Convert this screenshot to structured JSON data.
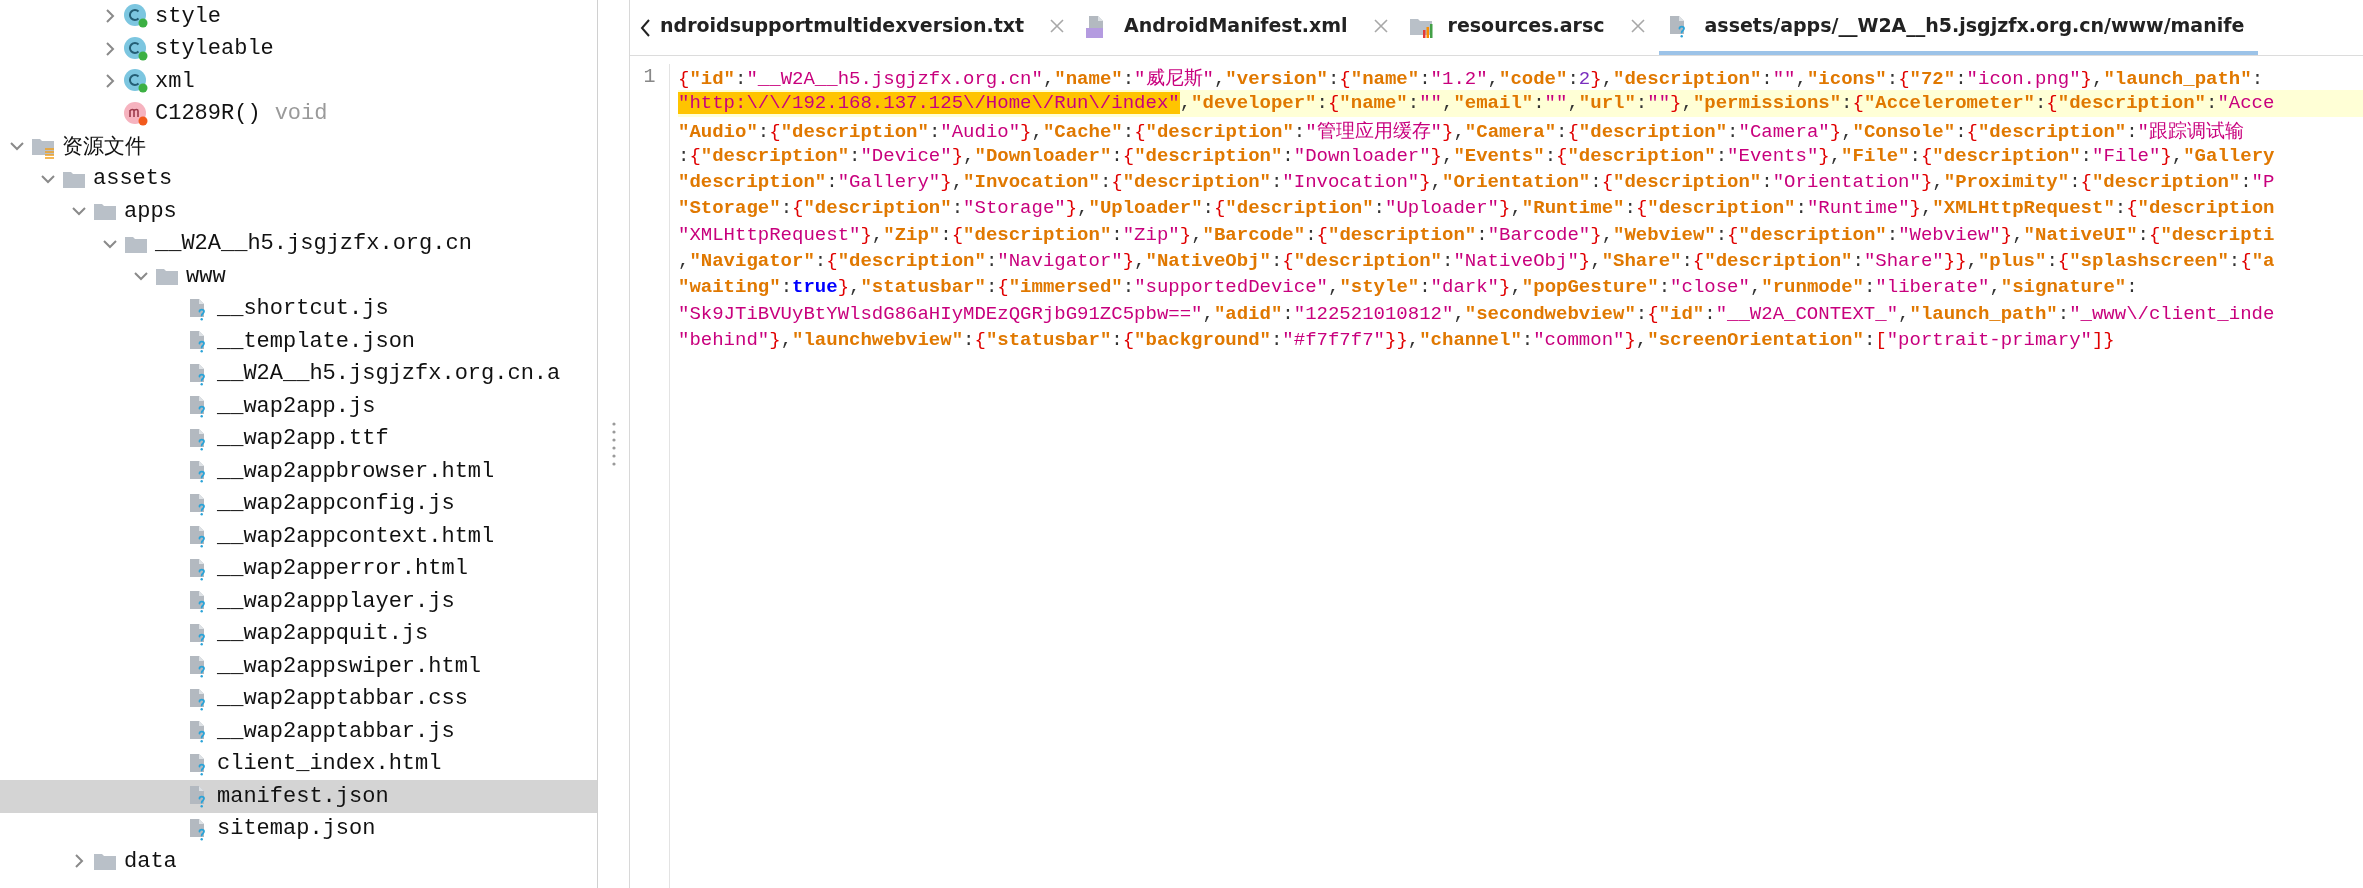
{
  "tree": {
    "partial_items": [
      {
        "label": "style",
        "kind": "class",
        "expanded": false,
        "selected": false
      },
      {
        "label": "styleable",
        "kind": "class",
        "expanded": false,
        "selected": false
      },
      {
        "label": "xml",
        "kind": "class",
        "expanded": false,
        "selected": false
      },
      {
        "label": "C1289R()",
        "suffix": "void",
        "kind": "method",
        "selected": false
      }
    ],
    "items": [
      {
        "label": "资源文件",
        "kind": "resources",
        "expanded": true,
        "selected": false,
        "children": [
          {
            "label": "assets",
            "kind": "folder",
            "expanded": true,
            "selected": false,
            "children": [
              {
                "label": "apps",
                "kind": "folder",
                "expanded": true,
                "selected": false,
                "children": [
                  {
                    "label": "__W2A__h5.jsgjzfx.org.cn",
                    "kind": "folder",
                    "expanded": true,
                    "selected": false,
                    "children": [
                      {
                        "label": "www",
                        "kind": "folder",
                        "expanded": true,
                        "selected": false,
                        "children": [
                          {
                            "label": "__shortcut.js",
                            "kind": "file",
                            "selected": false
                          },
                          {
                            "label": "__template.json",
                            "kind": "file",
                            "selected": false
                          },
                          {
                            "label": "__W2A__h5.jsgjzfx.org.cn.a",
                            "kind": "file",
                            "selected": false
                          },
                          {
                            "label": "__wap2app.js",
                            "kind": "file",
                            "selected": false
                          },
                          {
                            "label": "__wap2app.ttf",
                            "kind": "file",
                            "selected": false
                          },
                          {
                            "label": "__wap2appbrowser.html",
                            "kind": "file",
                            "selected": false
                          },
                          {
                            "label": "__wap2appconfig.js",
                            "kind": "file",
                            "selected": false
                          },
                          {
                            "label": "__wap2appcontext.html",
                            "kind": "file",
                            "selected": false
                          },
                          {
                            "label": "__wap2apperror.html",
                            "kind": "file",
                            "selected": false
                          },
                          {
                            "label": "__wap2appplayer.js",
                            "kind": "file",
                            "selected": false
                          },
                          {
                            "label": "__wap2appquit.js",
                            "kind": "file",
                            "selected": false
                          },
                          {
                            "label": "__wap2appswiper.html",
                            "kind": "file",
                            "selected": false
                          },
                          {
                            "label": "__wap2apptabbar.css",
                            "kind": "file",
                            "selected": false
                          },
                          {
                            "label": "__wap2apptabbar.js",
                            "kind": "file",
                            "selected": false
                          },
                          {
                            "label": "client_index.html",
                            "kind": "file",
                            "selected": false
                          },
                          {
                            "label": "manifest.json",
                            "kind": "file",
                            "selected": true
                          },
                          {
                            "label": "sitemap.json",
                            "kind": "file",
                            "selected": false
                          }
                        ]
                      }
                    ]
                  }
                ]
              },
              {
                "label": "data",
                "kind": "folder",
                "expanded": false,
                "selected": false
              }
            ]
          }
        ]
      }
    ]
  },
  "tabs": [
    {
      "label": "ndroidsupportmultidexversion.txt",
      "kind": "none",
      "selected": false
    },
    {
      "label": "AndroidManifest.xml",
      "kind": "manifest",
      "selected": false
    },
    {
      "label": "resources.arsc",
      "kind": "resources-table",
      "selected": false
    },
    {
      "label": "assets/apps/__W2A__h5.jsgjzfx.org.cn/www/manife",
      "kind": "file",
      "selected": true
    }
  ],
  "editor": {
    "line_number": "1",
    "rows": [
      {
        "current": false,
        "segments": [
          {
            "text": "{\"id\":\"__W2A__h5.jsgjzfx.org.cn\",\"name\":\"威尼斯\",\"version\":{\"name\":\"1.2\",\"code\":2},\"description\":\"\",\"icons\":{\"72\":\"icon.png\"},\"launch_path\":",
            "selected": false
          }
        ]
      },
      {
        "current": true,
        "segments": [
          {
            "text": "\"http:\\/\\/192.168.137.125\\/Home\\/Run\\/index\"",
            "selected": true
          },
          {
            "text": ",\"developer\":{\"name\":\"\",\"email\":\"\",\"url\":\"\"},\"permissions\":{\"Accelerometer\":{\"description\":\"Acce",
            "selected": false
          }
        ]
      },
      {
        "current": false,
        "segments": [
          {
            "text": "\"Audio\":{\"description\":\"Audio\"},\"Cache\":{\"description\":\"管理应用缓存\"},\"Camera\":{\"description\":\"Camera\"},\"Console\":{\"description\":\"跟踪调试输",
            "selected": false
          }
        ]
      },
      {
        "current": false,
        "segments": [
          {
            "text": ":{\"description\":\"Device\"},\"Downloader\":{\"description\":\"Downloader\"},\"Events\":{\"description\":\"Events\"},\"File\":{\"description\":\"File\"},\"Gallery",
            "selected": false
          }
        ]
      },
      {
        "current": false,
        "segments": [
          {
            "text": "\"description\":\"Gallery\"},\"Invocation\":{\"description\":\"Invocation\"},\"Orientation\":{\"description\":\"Orientation\"},\"Proximity\":{\"description\":\"P",
            "selected": false
          }
        ]
      },
      {
        "current": false,
        "segments": [
          {
            "text": "\"Storage\":{\"description\":\"Storage\"},\"Uploader\":{\"description\":\"Uploader\"},\"Runtime\":{\"description\":\"Runtime\"},\"XMLHttpRequest\":{\"description",
            "selected": false
          }
        ]
      },
      {
        "current": false,
        "segments": [
          {
            "text": "\"XMLHttpRequest\"},\"Zip\":{\"description\":\"Zip\"},\"Barcode\":{\"description\":\"Barcode\"},\"Webview\":{\"description\":\"Webview\"},\"NativeUI\":{\"descripti",
            "selected": false
          }
        ]
      },
      {
        "current": false,
        "segments": [
          {
            "text": ",\"Navigator\":{\"description\":\"Navigator\"},\"NativeObj\":{\"description\":\"NativeObj\"},\"Share\":{\"description\":\"Share\"}},\"plus\":{\"splashscreen\":{\"a",
            "selected": false
          }
        ]
      },
      {
        "current": false,
        "segments": [
          {
            "text": "\"waiting\":true},\"statusbar\":{\"immersed\":\"supportedDevice\",\"style\":\"dark\"},\"popGesture\":\"close\",\"runmode\":\"liberate\",\"signature\":",
            "selected": false
          }
        ]
      },
      {
        "current": false,
        "segments": [
          {
            "text": "\"Sk9JTiBVUyBtYWlsdG86aHIyMDEzQGRjbG91ZC5pbw==\",\"adid\":\"122521010812\",\"secondwebview\":{\"id\":\"__W2A_CONTEXT_\",\"launch_path\":\"_www\\/client_inde",
            "selected": false
          }
        ]
      },
      {
        "current": false,
        "segments": [
          {
            "text": "\"behind\"},\"launchwebview\":{\"statusbar\":{\"background\":\"#f7f7f7\"}},\"channel\":\"common\"},\"screenOrientation\":[\"portrait-primary\"]}",
            "selected": false
          }
        ]
      }
    ]
  }
}
